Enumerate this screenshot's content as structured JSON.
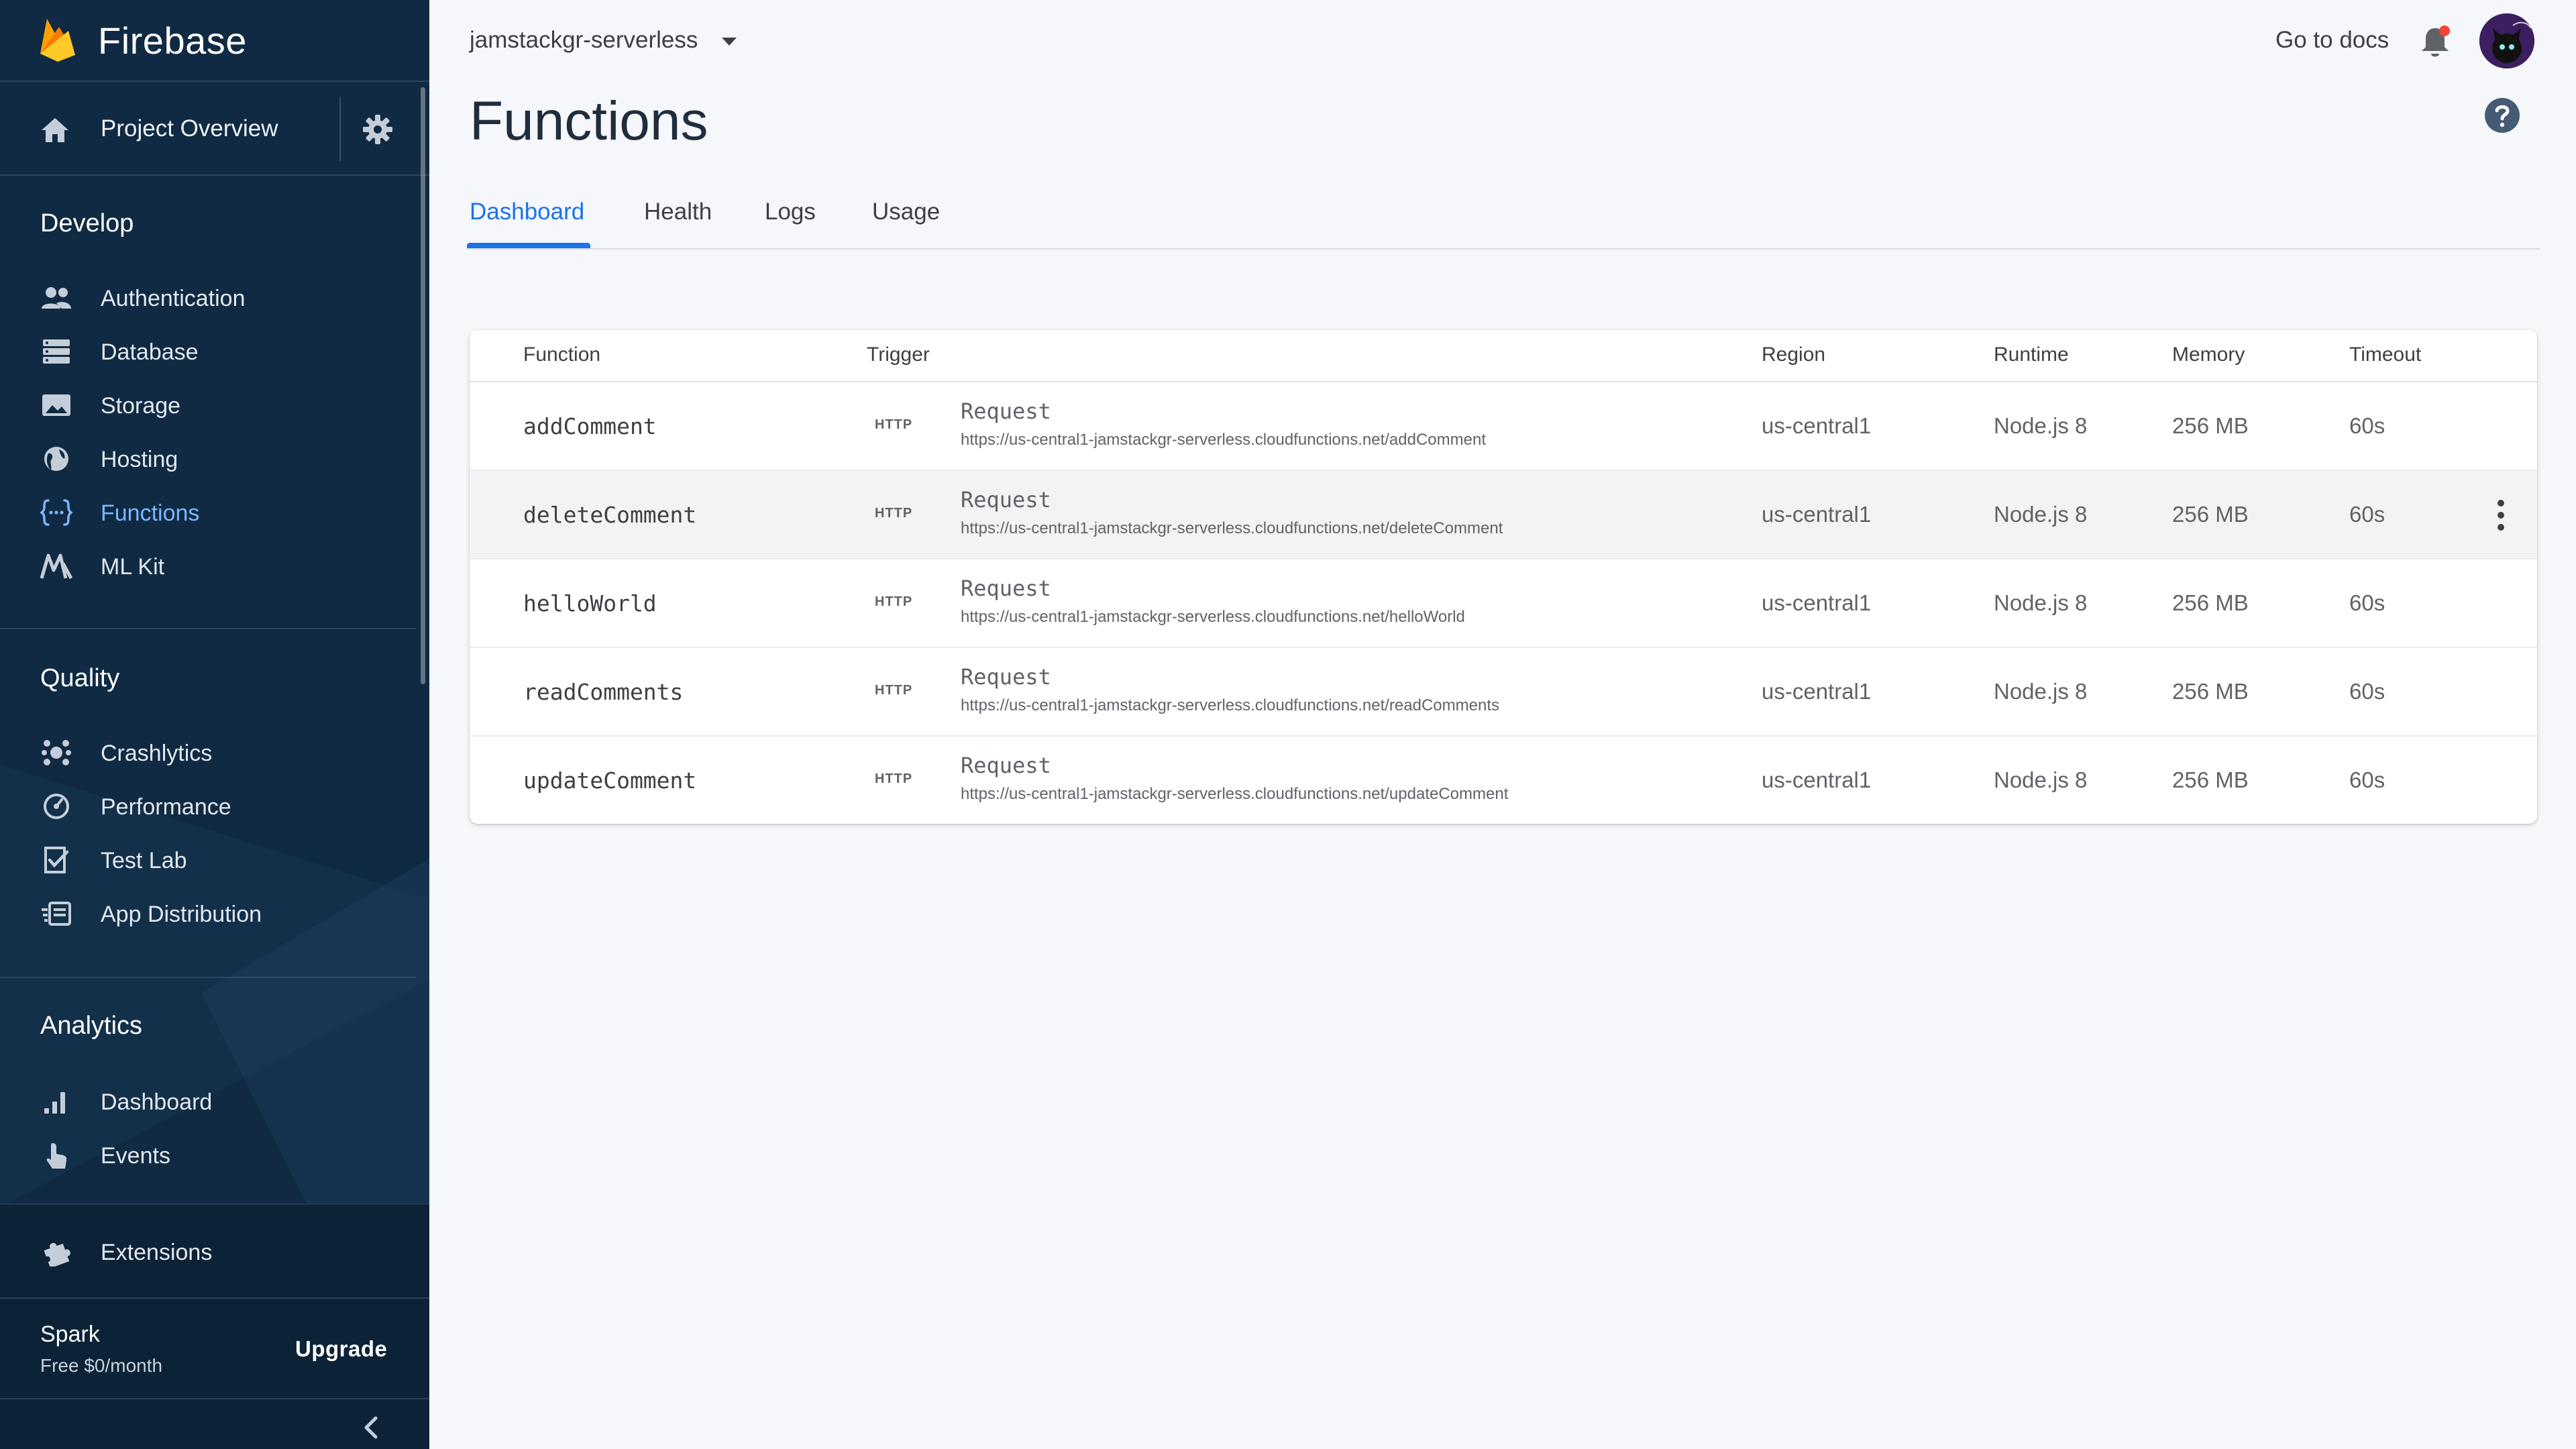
{
  "sidebar": {
    "brand": "Firebase",
    "overview_label": "Project Overview",
    "sections": [
      {
        "title": "Develop",
        "items": [
          {
            "label": "Authentication",
            "icon": "people-icon"
          },
          {
            "label": "Database",
            "icon": "database-icon"
          },
          {
            "label": "Storage",
            "icon": "image-icon"
          },
          {
            "label": "Hosting",
            "icon": "globe-icon"
          },
          {
            "label": "Functions",
            "icon": "functions-icon",
            "active": true
          },
          {
            "label": "ML Kit",
            "icon": "ml-kit-icon"
          }
        ]
      },
      {
        "title": "Quality",
        "items": [
          {
            "label": "Crashlytics",
            "icon": "crashlytics-icon"
          },
          {
            "label": "Performance",
            "icon": "speedometer-icon"
          },
          {
            "label": "Test Lab",
            "icon": "checklist-icon"
          },
          {
            "label": "App Distribution",
            "icon": "app-distribution-icon"
          }
        ]
      },
      {
        "title": "Analytics",
        "items": [
          {
            "label": "Dashboard",
            "icon": "bar-chart-icon"
          },
          {
            "label": "Events",
            "icon": "touch-icon"
          }
        ]
      }
    ],
    "extensions_label": "Extensions",
    "plan_name": "Spark",
    "plan_price": "Free $0/month",
    "upgrade_label": "Upgrade"
  },
  "header": {
    "project_name": "jamstackgr-serverless",
    "docs_label": "Go to docs"
  },
  "page": {
    "title": "Functions",
    "tabs": [
      "Dashboard",
      "Health",
      "Logs",
      "Usage"
    ]
  },
  "table": {
    "headers": {
      "function": "Function",
      "trigger": "Trigger",
      "region": "Region",
      "runtime": "Runtime",
      "memory": "Memory",
      "timeout": "Timeout"
    },
    "rows": [
      {
        "name": "addComment",
        "badge": "HTTP",
        "trigger": "Request",
        "url": "https://us-central1-jamstackgr-serverless.cloudfunctions.net/addComment",
        "region": "us-central1",
        "runtime": "Node.js 8",
        "memory": "256 MB",
        "timeout": "60s"
      },
      {
        "name": "deleteComment",
        "badge": "HTTP",
        "trigger": "Request",
        "url": "https://us-central1-jamstackgr-serverless.cloudfunctions.net/deleteComment",
        "region": "us-central1",
        "runtime": "Node.js 8",
        "memory": "256 MB",
        "timeout": "60s"
      },
      {
        "name": "helloWorld",
        "badge": "HTTP",
        "trigger": "Request",
        "url": "https://us-central1-jamstackgr-serverless.cloudfunctions.net/helloWorld",
        "region": "us-central1",
        "runtime": "Node.js 8",
        "memory": "256 MB",
        "timeout": "60s"
      },
      {
        "name": "readComments",
        "badge": "HTTP",
        "trigger": "Request",
        "url": "https://us-central1-jamstackgr-serverless.cloudfunctions.net/readComments",
        "region": "us-central1",
        "runtime": "Node.js 8",
        "memory": "256 MB",
        "timeout": "60s"
      },
      {
        "name": "updateComment",
        "badge": "HTTP",
        "trigger": "Request",
        "url": "https://us-central1-jamstackgr-serverless.cloudfunctions.net/updateComment",
        "region": "us-central1",
        "runtime": "Node.js 8",
        "memory": "256 MB",
        "timeout": "60s"
      }
    ]
  },
  "colors": {
    "sidebar_bg": "#102a43",
    "accent": "#1a73e8",
    "active_nav": "#7ab7ff",
    "firebase_orange": "#ffa000",
    "firebase_yellow": "#ffca28",
    "notification_dot": "#f44336"
  }
}
